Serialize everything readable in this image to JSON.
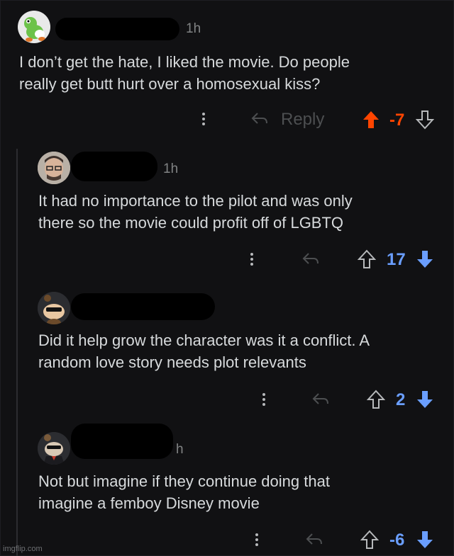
{
  "comments": [
    {
      "time": "1h",
      "body": "I don’t get the hate, I liked the movie. Do people\nreally get butt hurt over a homosexual kiss?",
      "reply_label": "Reply",
      "score": "-7",
      "vote_state": "upvoted",
      "avatar_icon": "yoshi-avatar-icon"
    },
    {
      "time": "1h",
      "body": "It had no importance to the pilot and was only\nthere so the movie could profit off of LGBTQ",
      "score": "17",
      "vote_state": "downvoted",
      "avatar_icon": "user-photo-avatar-icon"
    },
    {
      "time": "",
      "body": "Did it help grow the character was it a conflict. A\nrandom love story needs plot relevants",
      "score": "2",
      "vote_state": "downvoted",
      "avatar_icon": "snoo-sunglasses-avatar-icon"
    },
    {
      "time": "h",
      "body": "Not but imagine if they continue doing that\nimagine a femboy Disney movie",
      "score": "-6",
      "vote_state": "downvoted",
      "avatar_icon": "snoo-suit-avatar-icon"
    }
  ],
  "colors": {
    "upvote": "#ff4500",
    "downvote": "#6a9eff",
    "text": "#d7dadc"
  },
  "watermark": "imgflip.com"
}
